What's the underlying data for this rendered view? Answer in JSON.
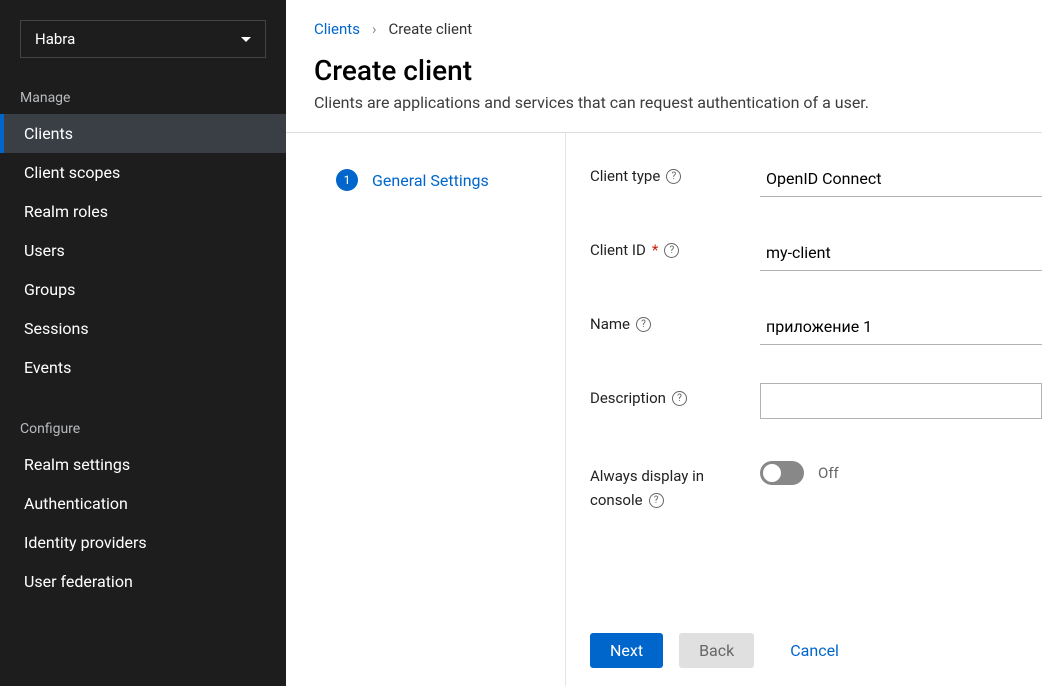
{
  "realm": {
    "selected": "Habra"
  },
  "sidebar": {
    "section_manage": "Manage",
    "section_configure": "Configure",
    "manage_items": [
      "Clients",
      "Client scopes",
      "Realm roles",
      "Users",
      "Groups",
      "Sessions",
      "Events"
    ],
    "configure_items": [
      "Realm settings",
      "Authentication",
      "Identity providers",
      "User federation"
    ],
    "active_index": 0
  },
  "breadcrumb": {
    "root": "Clients",
    "current": "Create client"
  },
  "page": {
    "title": "Create client",
    "description": "Clients are applications and services that can request authentication of a user."
  },
  "wizard": {
    "step_number": "1",
    "step_label": "General Settings"
  },
  "form": {
    "client_type_label": "Client type",
    "client_type_value": "OpenID Connect",
    "client_id_label": "Client ID",
    "client_id_value": "my-client",
    "name_label": "Name",
    "name_value": "приложение 1",
    "description_label": "Description",
    "description_value": "",
    "always_display_label_line1": "Always display in",
    "always_display_label_line2": "console",
    "always_display_state": "Off"
  },
  "buttons": {
    "next": "Next",
    "back": "Back",
    "cancel": "Cancel"
  }
}
